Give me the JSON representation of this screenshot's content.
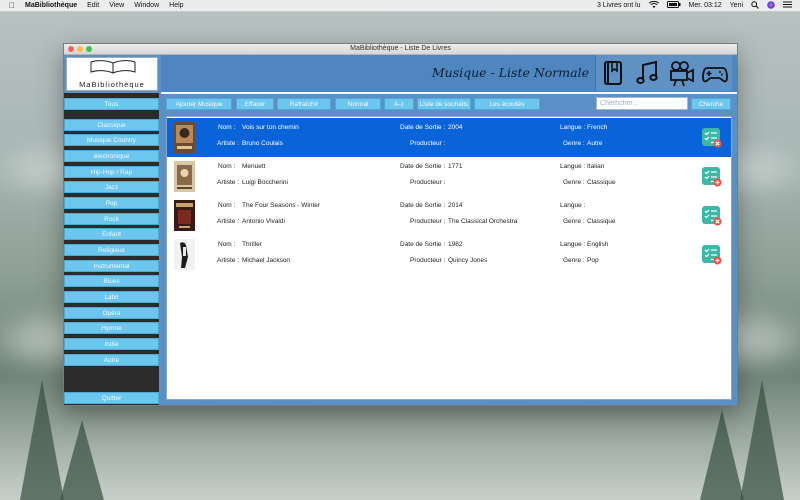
{
  "menubar": {
    "app_name": "MaBibliothèque",
    "menus": [
      "Edit",
      "View",
      "Window",
      "Help"
    ],
    "status": "3 Livres ont lu",
    "time": "Mer. 03:12",
    "user": "Yeni"
  },
  "window": {
    "title": "MaBibliothèque - Liste De Livres",
    "logo_text": "MaBibliothèque",
    "header_title": "Musique - Liste Normale"
  },
  "header_icons": [
    "book-icon",
    "music-note-icon",
    "movie-camera-icon",
    "gamepad-icon"
  ],
  "sidebar": {
    "items": [
      "Tous",
      "Classique",
      "Musique Country",
      "électronique",
      "Hip-Hop / Rap",
      "Jazz",
      "Pop",
      "Rock",
      "Enfant",
      "Religieux",
      "Instrumental",
      "Blues",
      "Latin",
      "Opéra",
      "Hymne",
      "Indie",
      "Autre"
    ],
    "quit": "Quitter"
  },
  "toolbar": {
    "buttons": [
      "Ajouter Musique",
      "Effacer",
      "Rafraîchir",
      "Normal",
      "A-z",
      "Liste de souhaits",
      "Les écoutés"
    ],
    "search_placeholder": "Cherhcher...",
    "search_button": "Cherche"
  },
  "labels": {
    "nom": "Nom :",
    "artiste": "Artiste :",
    "date": "Date de Sortie :",
    "producteur": "Producteur :",
    "langue": "Langue :",
    "genre": "Genre :"
  },
  "items": [
    {
      "nom": "Vois sur ton chemin",
      "artiste": "Bruno Coulais",
      "date": "2004",
      "producteur": "",
      "langue": "French",
      "genre": "Autre",
      "selected": true
    },
    {
      "nom": "Menuett",
      "artiste": "Luigi Boccherini",
      "date": "1771",
      "producteur": "",
      "langue": "Italian",
      "genre": "Classique",
      "selected": false
    },
    {
      "nom": "The Four Seasons - Winter",
      "artiste": "Antonio Vivaldi",
      "date": "2014",
      "producteur": "The Classical Orchestra",
      "langue": "",
      "genre": "Classique",
      "selected": false
    },
    {
      "nom": "Thriller",
      "artiste": "Michael Jackson",
      "date": "1982",
      "producteur": "Quincy Jones",
      "langue": "English",
      "genre": "Pop",
      "selected": false
    }
  ],
  "colors": {
    "window_bg": "#5a90c6",
    "button": "#6cc6ee",
    "selection": "#0a64d9",
    "badge": "#3cb8a6",
    "badge_remove": "#e8534a"
  }
}
